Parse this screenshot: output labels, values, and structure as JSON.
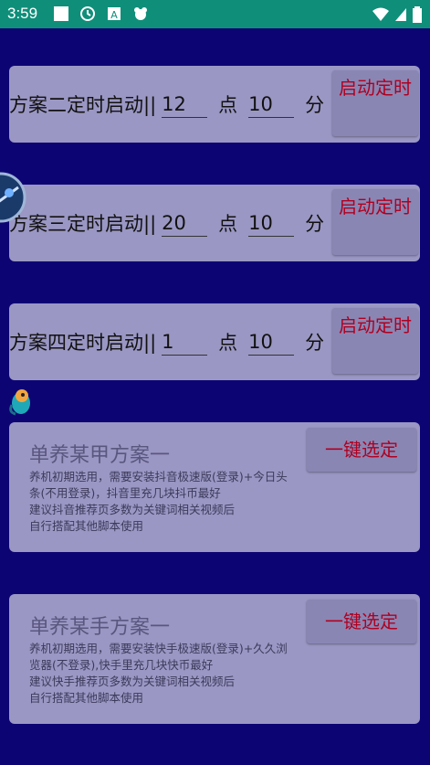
{
  "status_bar": {
    "time": "3:59"
  },
  "timers": [
    {
      "label": "方案二定时启动||",
      "hour": "12",
      "hour_unit": "点",
      "minute": "10",
      "minute_unit": "分",
      "button": "启动定时"
    },
    {
      "label": "方案三定时启动||",
      "hour": "20",
      "hour_unit": "点",
      "minute": "10",
      "minute_unit": "分",
      "button": "启动定时"
    },
    {
      "label": "方案四定时启动||",
      "hour": "1",
      "hour_unit": "点",
      "minute": "10",
      "minute_unit": "分",
      "button": "启动定时"
    }
  ],
  "plans": [
    {
      "title": "单养某甲方案一",
      "desc": [
        "养机初期选用，需要安装抖音极速版(登录)+今日头条(不用登录)，抖音里充几块抖币最好",
        "建议抖音推荐页多数为关键词相关视频后",
        "自行搭配其他脚本使用"
      ],
      "button": "一键选定"
    },
    {
      "title": "单养某手方案一",
      "desc": [
        "养机初期选用，需要安装快手极速版(登录)+久久浏览器(不登录),快手里充几块快币最好",
        "建议快手推荐页多数为关键词相关视频后",
        "自行搭配其他脚本使用"
      ],
      "button": "一键选定"
    }
  ],
  "colors": {
    "background": "#0d0474",
    "card": "#9a97c4",
    "status_bar": "#0f8f7a",
    "button_text": "#b00020"
  }
}
